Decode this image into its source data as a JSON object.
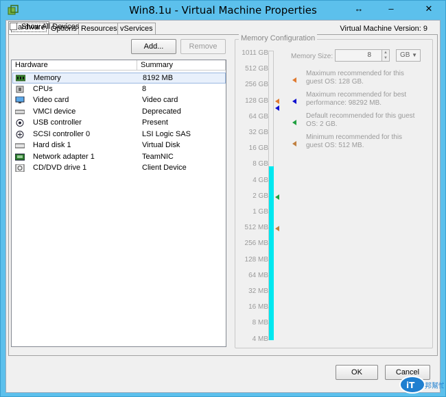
{
  "window": {
    "title": "Win8.1u - Virtual Machine Properties",
    "buttons": {
      "restore": "↔",
      "minimize": "–",
      "close": "✕"
    }
  },
  "tabs": [
    {
      "label": "Hardware",
      "active": true
    },
    {
      "label": "Options",
      "active": false
    },
    {
      "label": "Resources",
      "active": false
    },
    {
      "label": "vServices",
      "active": false
    }
  ],
  "vm_version": "Virtual Machine Version: 9",
  "hardware_panel": {
    "show_all_devices": "Show All Devices",
    "add_button": "Add...",
    "remove_button": "Remove",
    "columns": [
      "Hardware",
      "Summary"
    ],
    "rows": [
      {
        "name": "Memory",
        "summary": "8192 MB",
        "icon": "memory-icon",
        "selected": true
      },
      {
        "name": "CPUs",
        "summary": "8",
        "icon": "cpu-icon"
      },
      {
        "name": "Video card",
        "summary": "Video card",
        "icon": "monitor-icon"
      },
      {
        "name": "VMCI device",
        "summary": "Deprecated",
        "icon": "vmci-icon"
      },
      {
        "name": "USB controller",
        "summary": "Present",
        "icon": "usb-icon"
      },
      {
        "name": "SCSI controller 0",
        "summary": "LSI Logic SAS",
        "icon": "scsi-icon"
      },
      {
        "name": "Hard disk 1",
        "summary": "Virtual Disk",
        "icon": "disk-icon"
      },
      {
        "name": "Network adapter 1",
        "summary": "TeamNIC",
        "icon": "network-icon"
      },
      {
        "name": "CD/DVD drive 1",
        "summary": "Client Device",
        "icon": "cdrom-icon"
      }
    ]
  },
  "memory_config": {
    "group_title": "Memory Configuration",
    "memory_size_label": "Memory Size:",
    "memory_size_value": "8",
    "memory_unit": "GB",
    "scale": [
      "1011 GB",
      "512 GB",
      "256 GB",
      "128 GB",
      "64 GB",
      "32 GB",
      "16 GB",
      "8 GB",
      "4 GB",
      "2 GB",
      "1 GB",
      "512 MB",
      "256 MB",
      "128 MB",
      "64 MB",
      "32 MB",
      "16 MB",
      "8 MB",
      "4 MB"
    ],
    "fill_fraction": 0.6,
    "markers": [
      {
        "text": "Maximum recommended for this guest OS: 128 GB.",
        "color": "#e07a30",
        "level": "128 GB"
      },
      {
        "text": "Maximum recommended for best performance: 98292 MB.",
        "color": "#1010d0",
        "level": "98292 MB"
      },
      {
        "text": "Default recommended for this guest OS: 2 GB.",
        "color": "#20a040",
        "level": "2 GB"
      },
      {
        "text": "Minimum recommended for this guest OS: 512 MB.",
        "color": "#c08040",
        "level": "512 MB"
      }
    ]
  },
  "footer": {
    "ok_button": "OK",
    "cancel_button": "Cancel"
  },
  "watermark": {
    "text": "iT邦幫忙"
  }
}
